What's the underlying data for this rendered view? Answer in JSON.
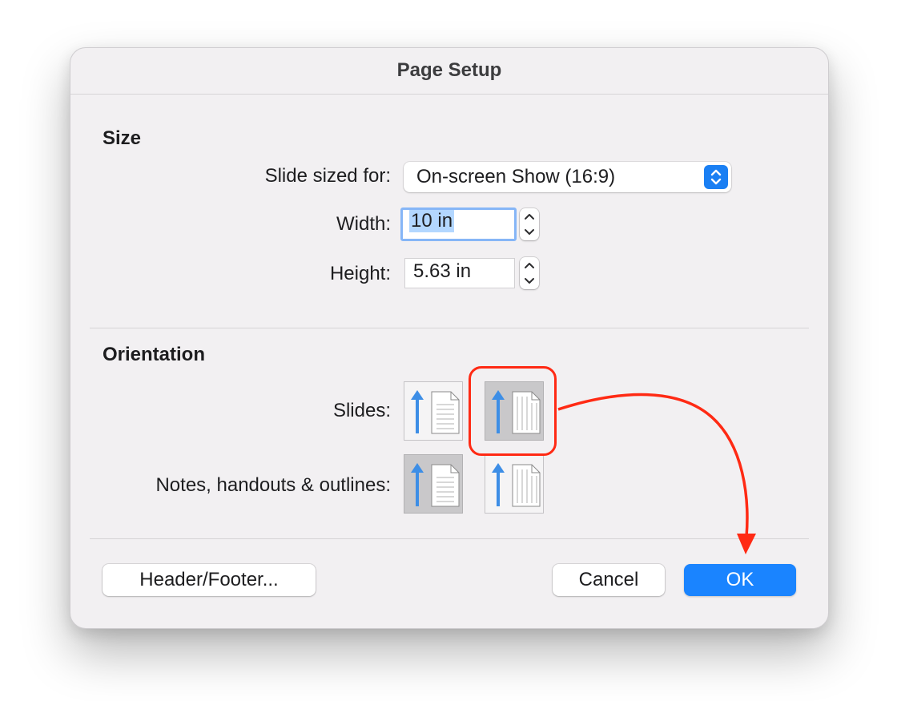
{
  "dialog": {
    "title": "Page Setup"
  },
  "size_section": {
    "heading": "Size",
    "slide_sized_for_label": "Slide sized for:",
    "slide_sized_for_value": "On-screen Show (16:9)",
    "width_label": "Width:",
    "width_value": "10 in",
    "height_label": "Height:",
    "height_value": "5.63 in"
  },
  "orientation_section": {
    "heading": "Orientation",
    "slides_label": "Slides:",
    "slides_selected": "portrait",
    "notes_label": "Notes, handouts & outlines:",
    "notes_selected": "portrait"
  },
  "buttons": {
    "header_footer": "Header/Footer...",
    "cancel": "Cancel",
    "ok": "OK"
  },
  "colors": {
    "accent": "#1a84ff",
    "annotation": "#ff2a14",
    "arrow_icon": "#3d8ee6"
  },
  "icons": [
    "chevron-updown-icon",
    "stepper-up-icon",
    "stepper-down-icon",
    "portrait-orientation-icon",
    "landscape-orientation-icon"
  ]
}
